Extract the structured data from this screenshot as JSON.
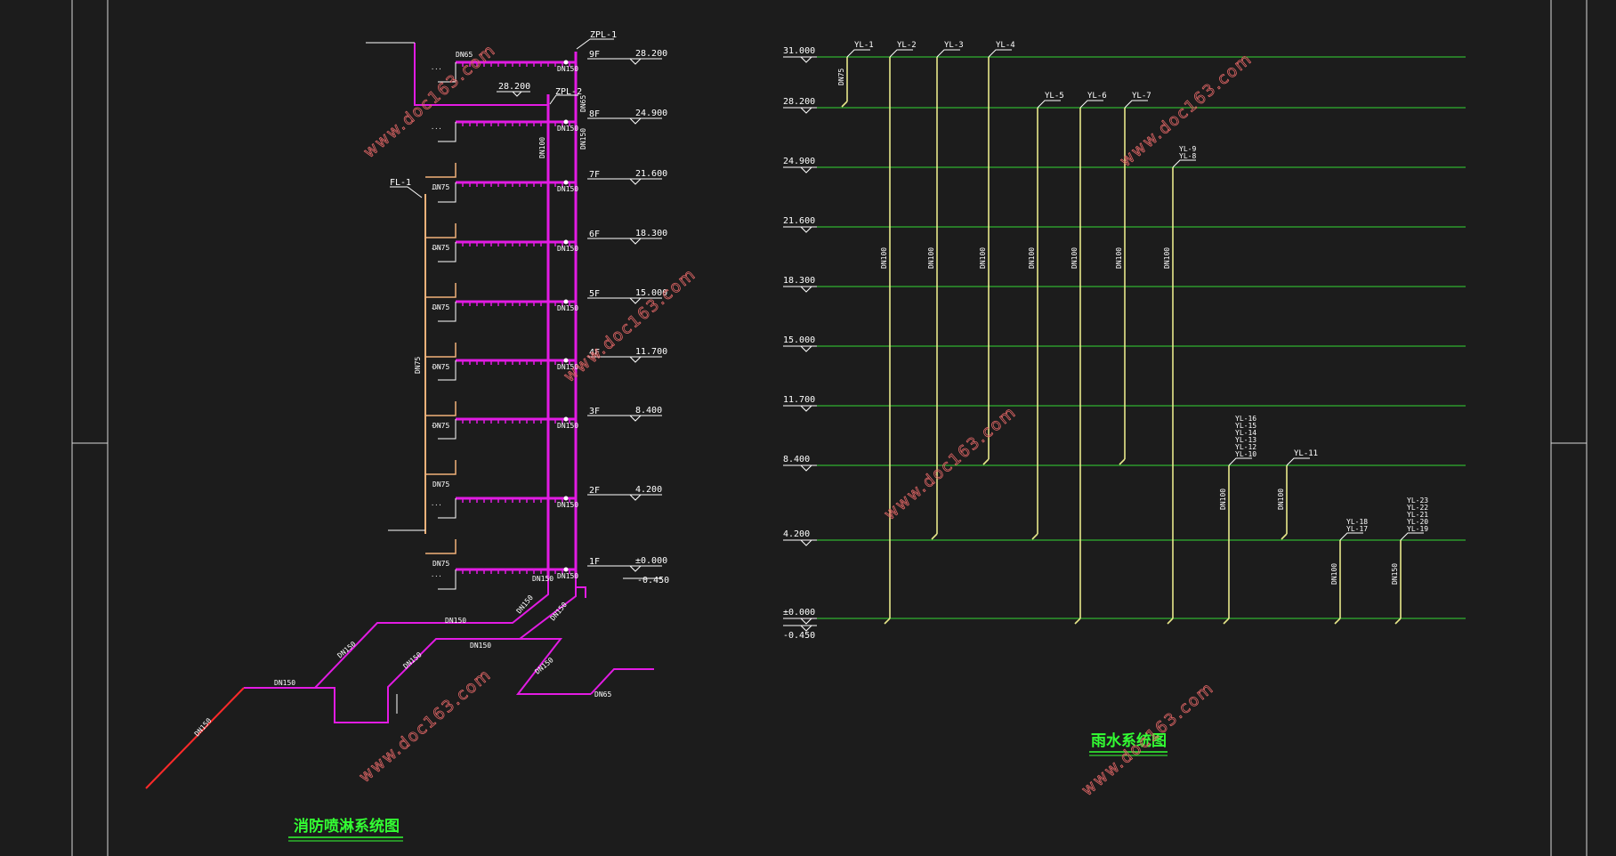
{
  "colors": {
    "background": "#1c1c1c",
    "frame": "#d8d8d8",
    "magenta": "#e21be3",
    "green_level": "#33d633",
    "yellow_pipe": "#e8e88a",
    "orange_pipe": "#f2b27a",
    "red_pipe": "#ff2a2a",
    "text": "#ffffff",
    "title_green": "#33ff33",
    "watermark": "#e06666"
  },
  "watermark": "www.doc163.com",
  "sprinkler": {
    "title": "消防喷淋系统图",
    "riser_labels": [
      "ZPL-1",
      "ZPL-2",
      "FL-1"
    ],
    "floor_labels": [
      "9F",
      "8F",
      "7F",
      "6F",
      "5F",
      "4F",
      "3F",
      "2F",
      "1F"
    ],
    "elevations": [
      "28.200",
      "24.900",
      "21.600",
      "18.300",
      "15.000",
      "11.700",
      "8.400",
      "4.200",
      "±0.000",
      "-0.450"
    ],
    "mid_elevation": "28.200",
    "pipe_labels": {
      "main_riser": "DN150",
      "branch_top": "DN65",
      "riser_left": "DN100",
      "branch": "DN150",
      "fl_branch": "DN75",
      "fl_riser": "DN75",
      "base_a": "DN150",
      "base_b": "DN150",
      "base_c": "DN150",
      "base_d": "DN150",
      "base_e": "DN150",
      "base_f": "DN150",
      "base_red": "DN150",
      "base_g": "DN150",
      "small": "DN65"
    }
  },
  "rainwater": {
    "title": "雨水系统图",
    "levels": [
      "31.000",
      "28.200",
      "24.900",
      "21.600",
      "18.300",
      "15.000",
      "11.700",
      "8.400",
      "4.200",
      "±0.000",
      "-0.450"
    ],
    "pipes": [
      {
        "label": "YL-1",
        "size": "DN75"
      },
      {
        "label": "YL-2",
        "size": "DN100"
      },
      {
        "label": "YL-3",
        "size": "DN100"
      },
      {
        "label": "YL-4",
        "size": "DN100"
      },
      {
        "label": "YL-5",
        "size": "DN100"
      },
      {
        "label": "YL-6",
        "size": "DN100"
      },
      {
        "label": "YL-7",
        "size": "DN100"
      },
      {
        "label": "YL-8",
        "size": "DN100"
      },
      {
        "label": "YL-16",
        "size": "DN100"
      },
      {
        "label": "YL-11",
        "size": "DN100"
      },
      {
        "label": "YL-18",
        "size": "DN100"
      },
      {
        "label": "YL-23",
        "size": "DN150"
      }
    ],
    "stacked_labels": {
      "yl8": [
        "YL-9",
        "YL-8"
      ],
      "yl16": [
        "YL-16",
        "YL-15",
        "YL-14",
        "YL-13",
        "YL-12",
        "YL-10"
      ],
      "yl18": [
        "YL-18",
        "YL-17"
      ],
      "yl23": [
        "YL-23",
        "YL-22",
        "YL-21",
        "YL-20",
        "YL-19"
      ]
    }
  }
}
